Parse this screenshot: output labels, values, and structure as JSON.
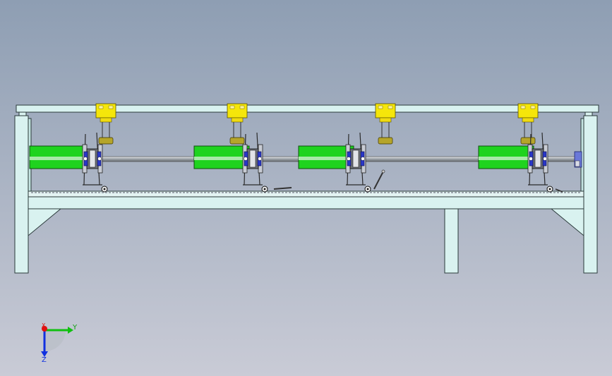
{
  "viewport": {
    "background_top": "#8e9eb3",
    "background_bottom": "#c9cbd6"
  },
  "colors": {
    "frame_fill": "#d9f2f0",
    "frame_stroke": "#2a3a3a",
    "roller_green": "#1fd31f",
    "yellow_block": "#f5e60a",
    "olive_part": "#b5a52a",
    "shaft": "#b8bcc2",
    "blue_part": "#2a37c8",
    "axis_red": "#e01010",
    "axis_green": "#10c010",
    "axis_blue": "#1030e0"
  },
  "triad": {
    "y_label": "Y",
    "z_label": "Z",
    "x_label": "X"
  },
  "assembly": {
    "station_count": 4,
    "roller_count": 4
  }
}
